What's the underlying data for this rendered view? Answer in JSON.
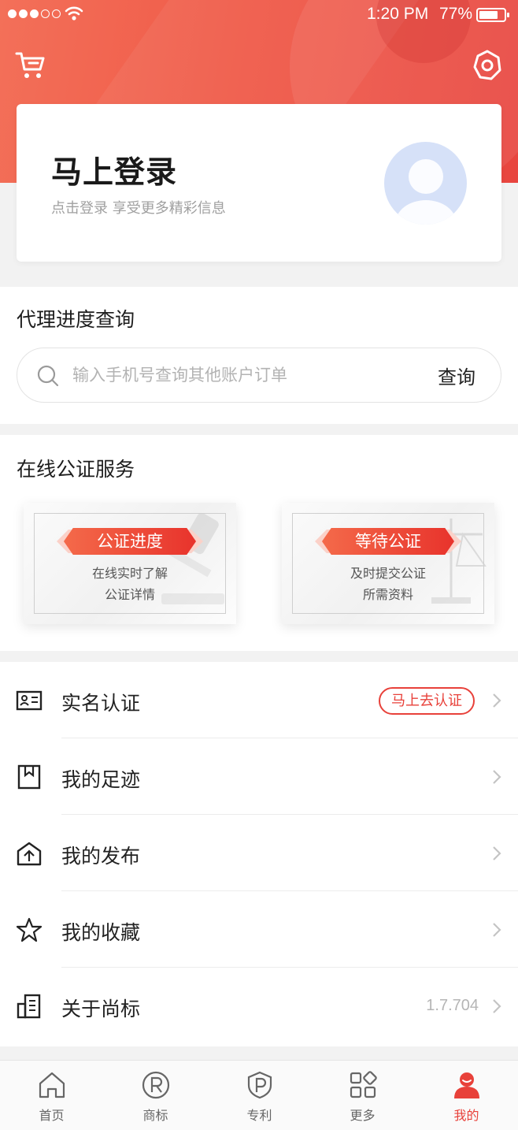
{
  "status_bar": {
    "time": "1:20 PM",
    "battery": "77%",
    "battery_level": 0.77
  },
  "header": {
    "cart_icon": "cart-icon",
    "settings_icon": "settings-icon"
  },
  "login_card": {
    "title": "马上登录",
    "subtitle": "点击登录 享受更多精彩信息",
    "avatar_icon": "default-avatar"
  },
  "agent_query": {
    "title": "代理进度查询",
    "search_placeholder": "输入手机号查询其他账户订单",
    "search_button": "查询"
  },
  "notary": {
    "title": "在线公证服务",
    "cards": [
      {
        "tag": "公证进度",
        "line1": "在线实时了解",
        "line2": "公证详情"
      },
      {
        "tag": "等待公证",
        "line1": "及时提交公证",
        "line2": "所需资料"
      }
    ]
  },
  "menu": [
    {
      "label": "实名认证",
      "badge": "马上去认证",
      "icon": "id-card-icon"
    },
    {
      "label": "我的足迹",
      "icon": "bookmark-icon"
    },
    {
      "label": "我的发布",
      "icon": "publish-icon"
    },
    {
      "label": "我的收藏",
      "icon": "star-icon"
    },
    {
      "label": "关于尚标",
      "value": "1.7.704",
      "icon": "building-icon"
    }
  ],
  "tabbar": [
    {
      "label": "首页",
      "icon": "home-icon"
    },
    {
      "label": "商标",
      "icon": "trademark-icon"
    },
    {
      "label": "专利",
      "icon": "patent-icon"
    },
    {
      "label": "更多",
      "icon": "grid-icon"
    },
    {
      "label": "我的",
      "icon": "profile-icon",
      "active": true
    }
  ],
  "colors": {
    "accent": "#e8413a",
    "header_gradient_start": "#f37059",
    "header_gradient_end": "#e8453f"
  }
}
